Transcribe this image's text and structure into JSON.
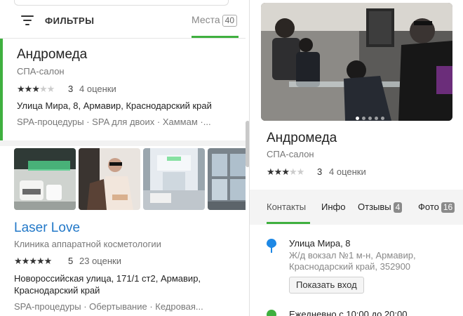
{
  "filters": {
    "label": "ФИЛЬТРЫ",
    "places_tab": "Места",
    "places_count": "40"
  },
  "list": [
    {
      "title": "Андромеда",
      "category": "СПА-салон",
      "rating": "3",
      "stars_filled": 3,
      "reviews": "4 оценки",
      "address": "Улица Мира, 8, Армавир, Краснодарский край",
      "tags": "SPA-процедуры · SPA для двоих · Хаммам ·..."
    },
    {
      "title": "Laser Love",
      "category": "Клиника аппаратной косметологии",
      "rating": "5",
      "stars_filled": 5,
      "reviews": "23 оценки",
      "address": "Новороссийская улица, 171/1 ст2, Армавир, Краснодарский край",
      "tags": "SPA-процедуры · Обертывание · Кедровая..."
    }
  ],
  "detail": {
    "title": "Андромеда",
    "category": "СПА-салон",
    "rating": "3",
    "stars_filled": 3,
    "reviews": "4 оценки",
    "tabs": [
      {
        "label": "Контакты",
        "count": ""
      },
      {
        "label": "Инфо",
        "count": ""
      },
      {
        "label": "Отзывы",
        "count": "4"
      },
      {
        "label": "Фото",
        "count": "16"
      }
    ],
    "address_line1": "Улица Мира, 8",
    "address_line2": "Ж/д вокзал №1 м-н, Армавир, Краснодарский край, 352900",
    "entrance_button": "Показать вход",
    "hours": "Ежедневно с 10:00 до 20:00"
  },
  "colors": {
    "accent": "#3fb03f",
    "link": "#2278c8",
    "pin": "#1e88e5"
  }
}
